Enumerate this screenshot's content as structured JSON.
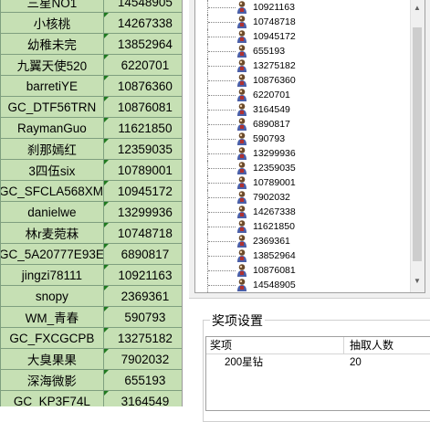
{
  "sheet": {
    "rows": [
      {
        "name": "三星NO1",
        "id": "14548905"
      },
      {
        "name": "小核桃",
        "id": "14267338"
      },
      {
        "name": "幼稚未完",
        "id": "13852964"
      },
      {
        "name": "九翼天使520",
        "id": "6220701"
      },
      {
        "name": "barretiYE",
        "id": "10876360"
      },
      {
        "name": "GC_DTF56TRN",
        "id": "10876081"
      },
      {
        "name": "RaymanGuo",
        "id": "11621850"
      },
      {
        "name": "刹那嫣红",
        "id": "12359035"
      },
      {
        "name": "3四伍six",
        "id": "10789001"
      },
      {
        "name": "GC_SFCLA568XM",
        "id": "10945172"
      },
      {
        "name": "danielwe",
        "id": "13299936"
      },
      {
        "name": "林r麦菀菻",
        "id": "10748718"
      },
      {
        "name": "GC_5A20777E93E",
        "id": "6890817"
      },
      {
        "name": "jingzi78111",
        "id": "10921163"
      },
      {
        "name": "snopy",
        "id": "2369361"
      },
      {
        "name": "WM_青春",
        "id": "590793"
      },
      {
        "name": "GC_FXCGCPB",
        "id": "13275182"
      },
      {
        "name": "大臭果果",
        "id": "7902032"
      },
      {
        "name": "深海微影",
        "id": "655193"
      },
      {
        "name": "GC_KP3F74L",
        "id": "3164549"
      }
    ]
  },
  "tree": {
    "items": [
      "10921163",
      "10748718",
      "10945172",
      "655193",
      "13275182",
      "10876360",
      "6220701",
      "3164549",
      "6890817",
      "590793",
      "13299936",
      "12359035",
      "10789001",
      "7902032",
      "14267338",
      "11621850",
      "2369361",
      "13852964",
      "10876081",
      "14548905"
    ]
  },
  "prize": {
    "title": "奖项设置",
    "columns": [
      "奖项",
      "抽取人数"
    ],
    "rows": [
      {
        "name": "200星钻",
        "count": "20"
      }
    ]
  }
}
